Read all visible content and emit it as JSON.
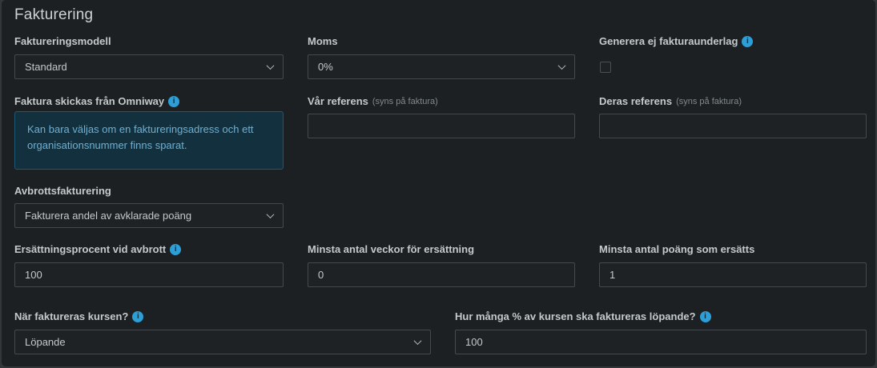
{
  "title": "Fakturering",
  "icons": {
    "info": "i"
  },
  "colors": {
    "panel_bg": "#1c2022",
    "accent_blue": "#2e9fd6",
    "info_box_bg": "#12303e",
    "info_box_border": "#1e5875",
    "info_box_text": "#6fb0d2"
  },
  "fields": {
    "faktureringsmodell": {
      "label": "Faktureringsmodell",
      "value": "Standard"
    },
    "moms": {
      "label": "Moms",
      "value": "0%"
    },
    "generera_ej_fakturaunderlag": {
      "label": "Generera ej fakturaunderlag",
      "checked": false
    },
    "faktura_skickas_fran_omniway": {
      "label": "Faktura skickas från Omniway",
      "info_text": "Kan bara väljas om en faktureringsadress och ett organisationsnummer finns sparat."
    },
    "var_referens": {
      "label": "Vår referens",
      "sublabel": "(syns på faktura)",
      "value": ""
    },
    "deras_referens": {
      "label": "Deras referens",
      "sublabel": "(syns på faktura)",
      "value": ""
    },
    "avbrottsfakturering": {
      "label": "Avbrottsfakturering",
      "value": "Fakturera andel av avklarade poäng"
    },
    "ersattningsprocent_vid_avbrott": {
      "label": "Ersättningsprocent vid avbrott",
      "value": "100"
    },
    "minsta_antal_veckor": {
      "label": "Minsta antal veckor för ersättning",
      "value": "0"
    },
    "minsta_antal_poang": {
      "label": "Minsta antal poäng som ersätts",
      "value": "1"
    },
    "nar_faktureras_kursen": {
      "label": "När faktureras kursen?",
      "value": "Löpande"
    },
    "hur_manga_procent": {
      "label": "Hur många % av kursen ska faktureras löpande?",
      "value": "100"
    }
  }
}
